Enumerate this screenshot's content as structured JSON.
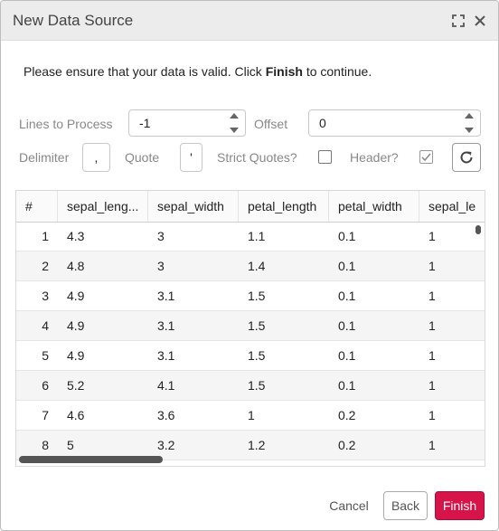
{
  "dialog": {
    "title": "New Data Source"
  },
  "instruction": {
    "prefix": "Please ensure that your data is valid. Click ",
    "bold": "Finish",
    "suffix": " to continue."
  },
  "options": {
    "lines_label": "Lines to Process",
    "lines_value": "-1",
    "offset_label": "Offset",
    "offset_value": "0",
    "delimiter_label": "Delimiter",
    "delimiter_value": ",",
    "quote_label": "Quote",
    "quote_value": "'",
    "strict_quotes_label": "Strict Quotes?",
    "strict_quotes_checked": false,
    "header_label": "Header?",
    "header_checked": true
  },
  "table": {
    "columns": [
      "#",
      "sepal_leng...",
      "sepal_width",
      "petal_length",
      "petal_width",
      "sepal_le"
    ],
    "rows": [
      [
        "1",
        "4.3",
        "3",
        "1.1",
        "0.1",
        "1"
      ],
      [
        "2",
        "4.8",
        "3",
        "1.4",
        "0.1",
        "1"
      ],
      [
        "3",
        "4.9",
        "3.1",
        "1.5",
        "0.1",
        "1"
      ],
      [
        "4",
        "4.9",
        "3.1",
        "1.5",
        "0.1",
        "1"
      ],
      [
        "5",
        "4.9",
        "3.1",
        "1.5",
        "0.1",
        "1"
      ],
      [
        "6",
        "5.2",
        "4.1",
        "1.5",
        "0.1",
        "1"
      ],
      [
        "7",
        "4.6",
        "3.6",
        "1",
        "0.2",
        "1"
      ],
      [
        "8",
        "5",
        "3.2",
        "1.2",
        "0.2",
        "1"
      ]
    ]
  },
  "buttons": {
    "cancel": "Cancel",
    "back": "Back",
    "finish": "Finish"
  },
  "colors": {
    "accent": "#d7144a",
    "titlebar": "#ececec"
  },
  "icons": {
    "maximize": "expand-icon",
    "close": "close-icon",
    "refresh": "refresh-icon"
  }
}
